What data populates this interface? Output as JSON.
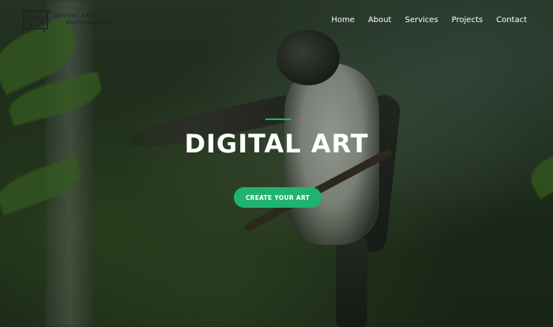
{
  "brand": {
    "line1": "DIGITAL ART",
    "line2": "PHOTOGRAPHY",
    "logo_icon": "palette-easel-icon"
  },
  "nav": {
    "items": [
      "Home",
      "About",
      "Services",
      "Projects",
      "Contact"
    ]
  },
  "hero": {
    "title": "DIGITAL ART",
    "cta_label": "CREATE YOUR ART",
    "accent_color": "#1fb36f",
    "background_image": "bird-on-branch-photo"
  }
}
